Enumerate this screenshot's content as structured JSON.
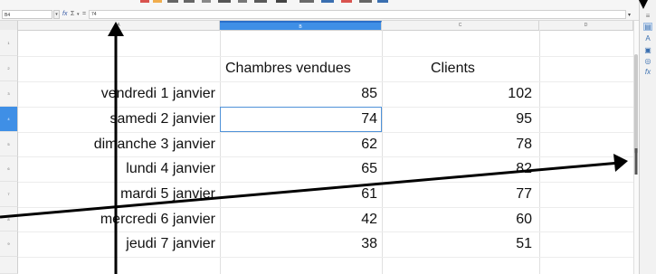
{
  "formula_bar": {
    "name_box": "B4",
    "sum_symbol": "Σ",
    "equals_symbol": "=",
    "formula_value": "74"
  },
  "columns": [
    "A",
    "B",
    "C",
    "D"
  ],
  "row_numbers": [
    "1",
    "2",
    "3",
    "4",
    "5",
    "6",
    "7",
    "8",
    "9"
  ],
  "headers": {
    "rooms": "Chambres vendues",
    "clients": "Clients"
  },
  "rows": [
    {
      "date": "vendredi 1 janvier",
      "rooms": "85",
      "clients": "102"
    },
    {
      "date": "samedi 2 janvier",
      "rooms": "74",
      "clients": "95"
    },
    {
      "date": "dimanche 3 janvier",
      "rooms": "62",
      "clients": "78"
    },
    {
      "date": "lundi 4 janvier",
      "rooms": "65",
      "clients": "82"
    },
    {
      "date": "mardi 5 janvier",
      "rooms": "61",
      "clients": "77"
    },
    {
      "date": "mercredi 6 janvier",
      "rooms": "42",
      "clients": "60"
    },
    {
      "date": "jeudi 7 janvier",
      "rooms": "38",
      "clients": "51"
    }
  ],
  "selection": {
    "column": "B",
    "row": "4"
  },
  "sidebar_icons": [
    "menu-icon",
    "properties-icon",
    "styles-icon",
    "gallery-icon",
    "navigator-icon",
    "functions-icon"
  ],
  "colors": {
    "selection": "#3f8fe6",
    "grid": "#e0e0e0"
  }
}
